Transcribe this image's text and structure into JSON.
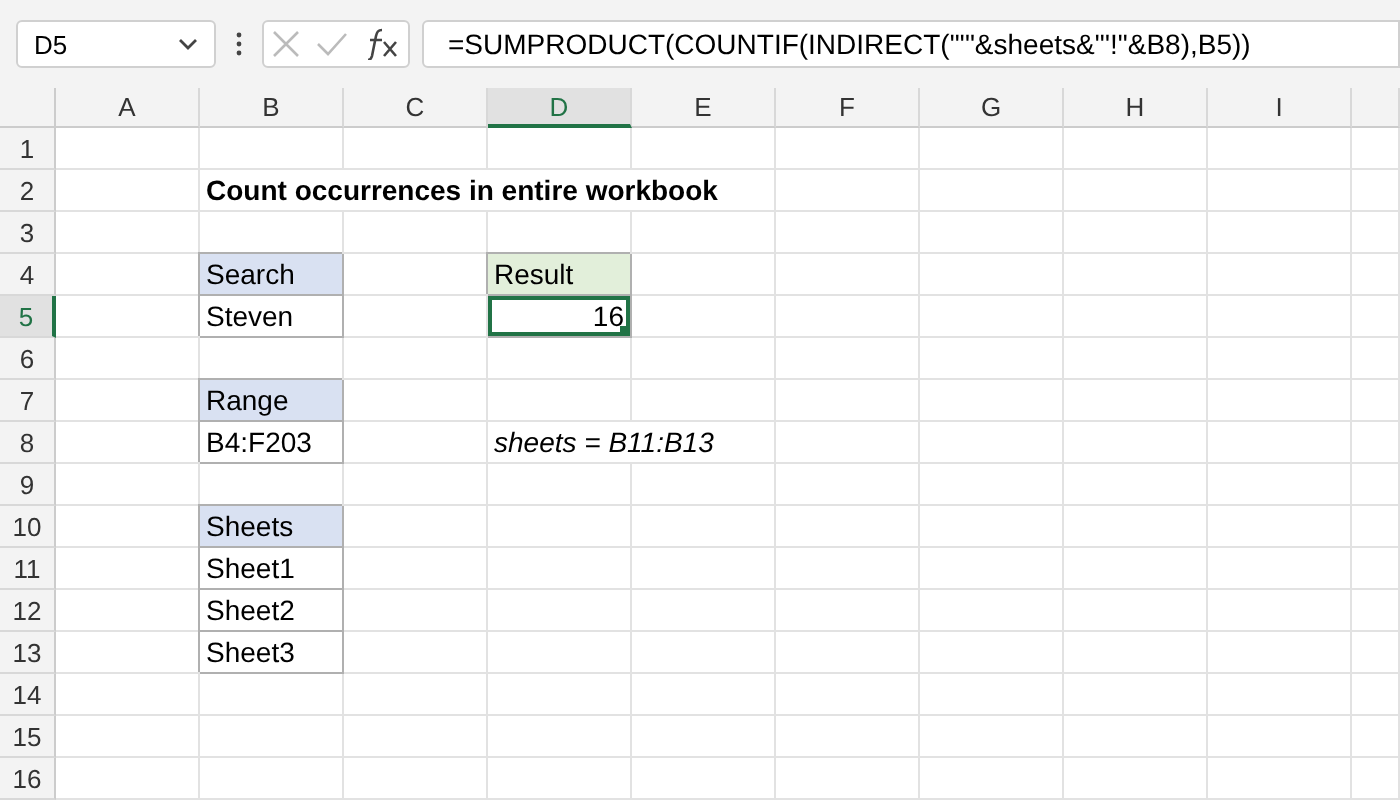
{
  "name_box": "D5",
  "formula": "=SUMPRODUCT(COUNTIF(INDIRECT(\"'\"&sheets&\"'!\"&B8),B5))",
  "columns": [
    {
      "label": "A",
      "selected": false
    },
    {
      "label": "B",
      "selected": false
    },
    {
      "label": "C",
      "selected": false
    },
    {
      "label": "D",
      "selected": true
    },
    {
      "label": "E",
      "selected": false
    },
    {
      "label": "F",
      "selected": false
    },
    {
      "label": "G",
      "selected": false
    },
    {
      "label": "H",
      "selected": false
    },
    {
      "label": "I",
      "selected": false
    }
  ],
  "rows": [
    {
      "number": "1",
      "selected": false,
      "cells": []
    },
    {
      "number": "2",
      "selected": false,
      "cells": [
        {
          "kind": "blank"
        },
        {
          "kind": "title",
          "text": "Count occurrences in entire workbook"
        }
      ]
    },
    {
      "number": "3",
      "selected": false,
      "cells": []
    },
    {
      "number": "4",
      "selected": false,
      "cells": [
        {
          "kind": "blank"
        },
        {
          "kind": "header",
          "text": "Search"
        },
        {
          "kind": "blank"
        },
        {
          "kind": "result_header",
          "text": "Result"
        }
      ]
    },
    {
      "number": "5",
      "selected": true,
      "cells": [
        {
          "kind": "blank"
        },
        {
          "kind": "value",
          "text": "Steven"
        },
        {
          "kind": "blank"
        },
        {
          "kind": "number",
          "text": "16",
          "selected": true
        }
      ]
    },
    {
      "number": "6",
      "selected": false,
      "cells": []
    },
    {
      "number": "7",
      "selected": false,
      "cells": [
        {
          "kind": "blank"
        },
        {
          "kind": "header",
          "text": "Range"
        }
      ]
    },
    {
      "number": "8",
      "selected": false,
      "cells": [
        {
          "kind": "blank"
        },
        {
          "kind": "value",
          "text": "B4:F203"
        },
        {
          "kind": "blank"
        },
        {
          "kind": "note",
          "text": "sheets = B11:B13"
        }
      ]
    },
    {
      "number": "9",
      "selected": false,
      "cells": []
    },
    {
      "number": "10",
      "selected": false,
      "cells": [
        {
          "kind": "blank"
        },
        {
          "kind": "header",
          "text": "Sheets"
        }
      ]
    },
    {
      "number": "11",
      "selected": false,
      "cells": [
        {
          "kind": "blank"
        },
        {
          "kind": "value",
          "text": "Sheet1"
        }
      ]
    },
    {
      "number": "12",
      "selected": false,
      "cells": [
        {
          "kind": "blank"
        },
        {
          "kind": "value",
          "text": "Sheet2"
        }
      ]
    },
    {
      "number": "13",
      "selected": false,
      "cells": [
        {
          "kind": "blank"
        },
        {
          "kind": "value",
          "text": "Sheet3"
        }
      ]
    },
    {
      "number": "14",
      "selected": false,
      "cells": []
    },
    {
      "number": "15",
      "selected": false,
      "cells": []
    },
    {
      "number": "16",
      "selected": false,
      "cells": []
    }
  ]
}
